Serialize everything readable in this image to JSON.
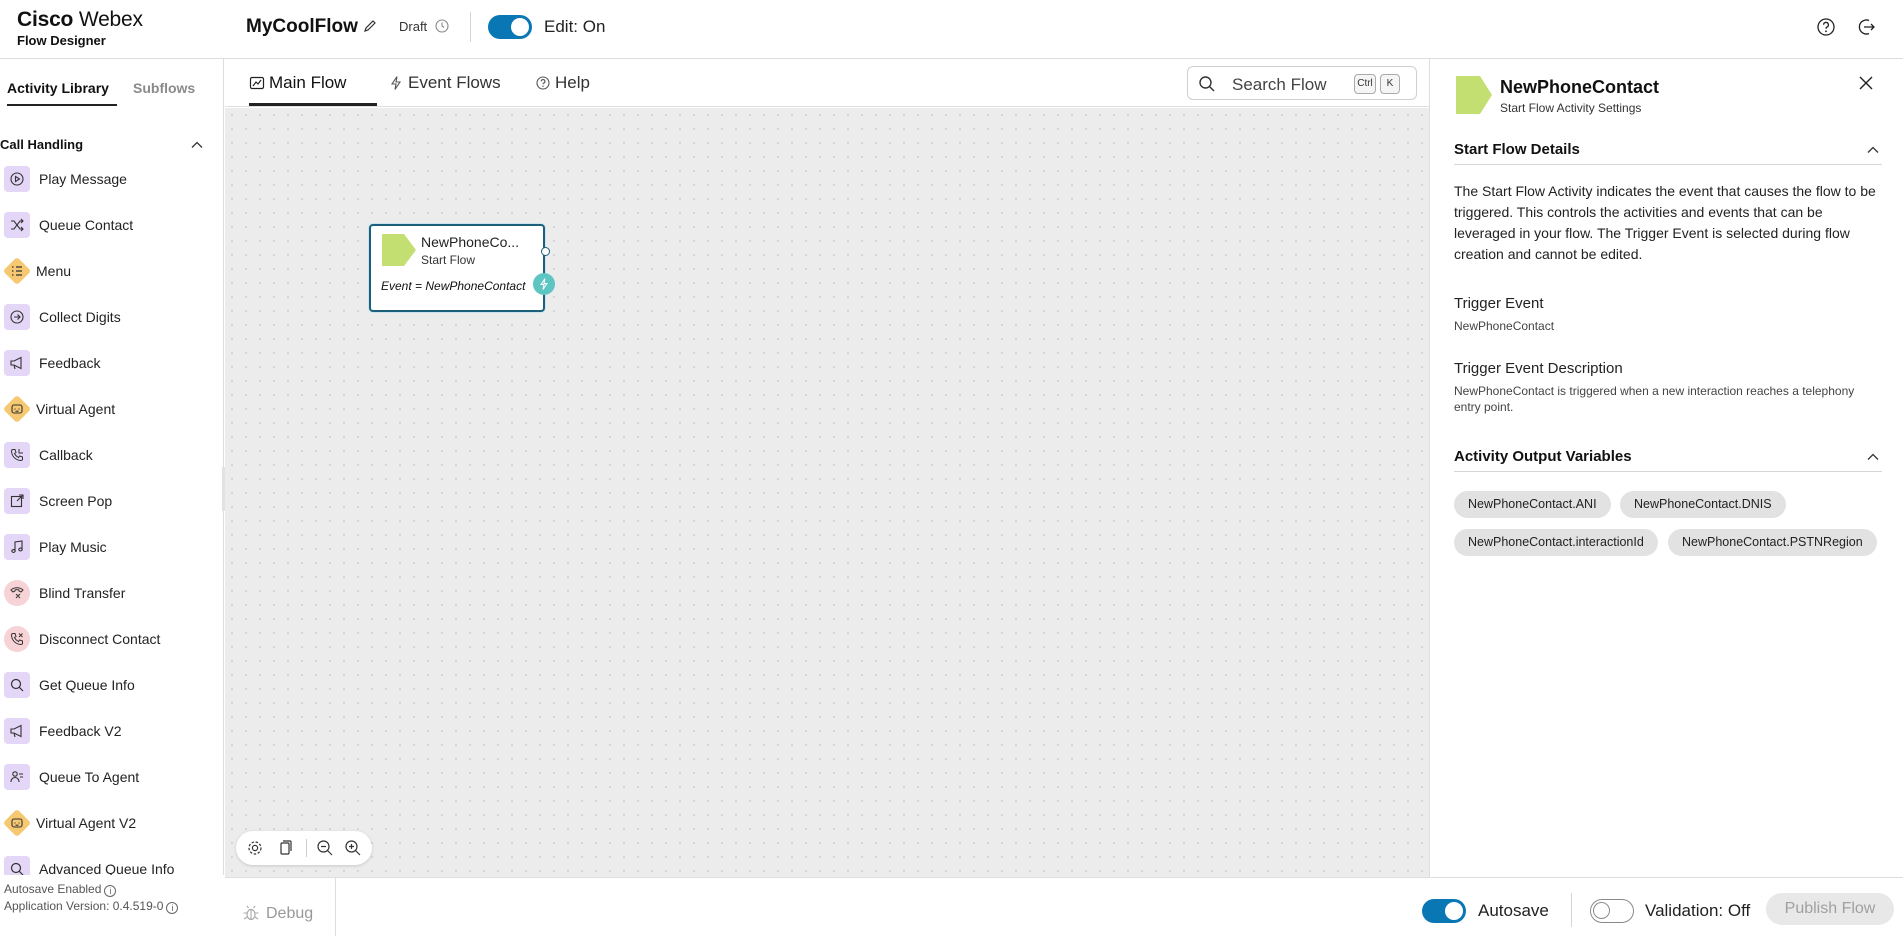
{
  "header": {
    "brand_cisco": "Cisco",
    "brand_webex": "Webex",
    "brand_sub": "Flow Designer",
    "flow_name": "MyCoolFlow",
    "status": "Draft",
    "edit_label": "Edit: On",
    "edit_on": true
  },
  "sidebar": {
    "tabs": [
      {
        "label": "Activity Library",
        "active": true
      },
      {
        "label": "Subflows",
        "active": false
      }
    ],
    "section_title": "Call Handling",
    "items": [
      {
        "label": "Play Message",
        "icon": "play-icon",
        "style": "purple"
      },
      {
        "label": "Queue Contact",
        "icon": "shuffle-icon",
        "style": "purple"
      },
      {
        "label": "Menu",
        "icon": "menu-list-icon",
        "style": "diamond"
      },
      {
        "label": "Collect Digits",
        "icon": "arrow-circle-icon",
        "style": "purple"
      },
      {
        "label": "Feedback",
        "icon": "megaphone-icon",
        "style": "purple"
      },
      {
        "label": "Virtual Agent",
        "icon": "bot-icon",
        "style": "diamond"
      },
      {
        "label": "Callback",
        "icon": "phone-callback-icon",
        "style": "purple"
      },
      {
        "label": "Screen Pop",
        "icon": "external-link-icon",
        "style": "purple"
      },
      {
        "label": "Play Music",
        "icon": "music-note-icon",
        "style": "purple"
      },
      {
        "label": "Blind Transfer",
        "icon": "transfer-icon",
        "style": "pink"
      },
      {
        "label": "Disconnect Contact",
        "icon": "phone-disconnect-icon",
        "style": "pink"
      },
      {
        "label": "Get Queue Info",
        "icon": "search-icon",
        "style": "purple"
      },
      {
        "label": "Feedback V2",
        "icon": "megaphone-icon",
        "style": "purple"
      },
      {
        "label": "Queue To Agent",
        "icon": "agent-icon",
        "style": "purple"
      },
      {
        "label": "Virtual Agent V2",
        "icon": "bot-icon",
        "style": "diamond"
      },
      {
        "label": "Advanced Queue Info",
        "icon": "search-icon",
        "style": "purple"
      }
    ],
    "footer_autosave": "Autosave Enabled",
    "footer_version": "Application Version: 0.4.519-0"
  },
  "center": {
    "tabs": [
      {
        "label": "Main Flow",
        "icon": "flow-chart-icon",
        "active": true
      },
      {
        "label": "Event Flows",
        "icon": "lightning-icon",
        "active": false
      },
      {
        "label": "Help",
        "icon": "help-circle-icon",
        "active": false
      }
    ],
    "search_placeholder": "Search Flow",
    "search_shortcut": [
      "Ctrl",
      "K"
    ]
  },
  "canvas": {
    "node": {
      "title": "NewPhoneCo...",
      "subtitle": "Start Flow",
      "event": "Event = NewPhoneContact",
      "color": "#c4df71"
    }
  },
  "panel": {
    "title": "NewPhoneContact",
    "subtitle": "Start Flow Activity Settings",
    "section1_title": "Start Flow Details",
    "description": "The Start Flow Activity indicates the event that causes the flow to be triggered. This controls the activities and events that can be leveraged in your flow. The Trigger Event is selected during flow creation and cannot be edited.",
    "trigger_event_label": "Trigger Event",
    "trigger_event_value": "NewPhoneContact",
    "trigger_desc_label": "Trigger Event Description",
    "trigger_desc_value": "NewPhoneContact is triggered when a new interaction reaches a telephony entry point.",
    "section2_title": "Activity Output Variables",
    "variables": [
      "NewPhoneContact.ANI",
      "NewPhoneContact.DNIS",
      "NewPhoneContact.interactionId",
      "NewPhoneContact.PSTNRegion"
    ]
  },
  "bottom": {
    "debug_label": "Debug",
    "autosave_label": "Autosave",
    "autosave_on": true,
    "validation_label": "Validation: Off",
    "validation_on": false,
    "publish_label": "Publish Flow"
  },
  "colors": {
    "accent": "#0a77b5",
    "node_border": "#1c5f7a",
    "event_port": "#5ec6c2",
    "start_shape": "#c4df71"
  }
}
